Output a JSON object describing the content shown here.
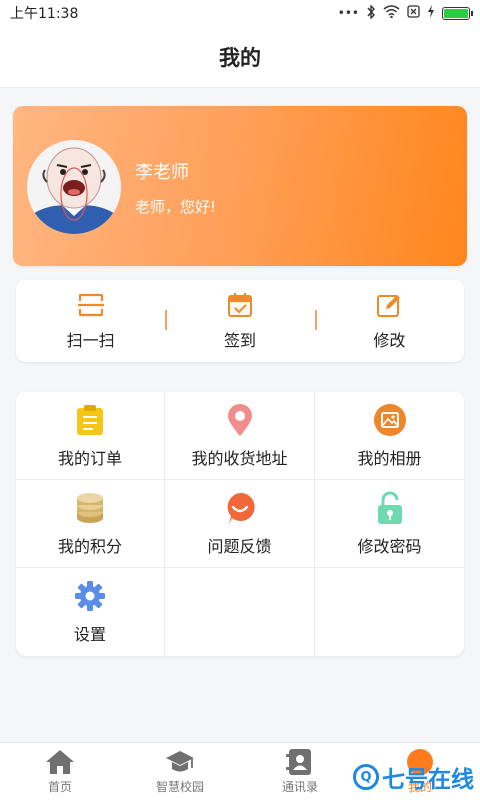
{
  "status_bar": {
    "time": "上午11:38",
    "dots": "•••"
  },
  "header": {
    "title": "我的"
  },
  "profile": {
    "name": "李老师",
    "greeting": "老师，您好!"
  },
  "quick_actions": [
    {
      "label": "扫一扫",
      "icon": "scan-icon"
    },
    {
      "label": "签到",
      "icon": "calendar-check-icon"
    },
    {
      "label": "修改",
      "icon": "edit-icon"
    }
  ],
  "menu_grid": [
    {
      "label": "我的订单",
      "icon": "order-clipboard-icon",
      "color": "#f5c518"
    },
    {
      "label": "我的收货地址",
      "icon": "location-pin-icon",
      "color": "#f28b8b"
    },
    {
      "label": "我的相册",
      "icon": "album-icon",
      "color": "#f0862a"
    },
    {
      "label": "我的积分",
      "icon": "coins-stack-icon",
      "color": "#d7b46a"
    },
    {
      "label": "问题反馈",
      "icon": "feedback-bubble-icon",
      "color": "#f0683a"
    },
    {
      "label": "修改密码",
      "icon": "unlock-icon",
      "color": "#6fd9b0"
    },
    {
      "label": "设置",
      "icon": "gear-icon",
      "color": "#5b8de8"
    }
  ],
  "tab_bar": [
    {
      "label": "首页",
      "icon": "home-icon",
      "active": false
    },
    {
      "label": "智慧校园",
      "icon": "graduation-cap-icon",
      "active": false
    },
    {
      "label": "通讯录",
      "icon": "contacts-icon",
      "active": false
    },
    {
      "label": "我的",
      "icon": "profile-icon",
      "active": true
    }
  ],
  "colors": {
    "accent": "#ff861c",
    "card_gradient_start": "#ffb681",
    "card_gradient_end": "#ff861c"
  },
  "watermark": {
    "text": "七号在线",
    "mark": "Q"
  }
}
